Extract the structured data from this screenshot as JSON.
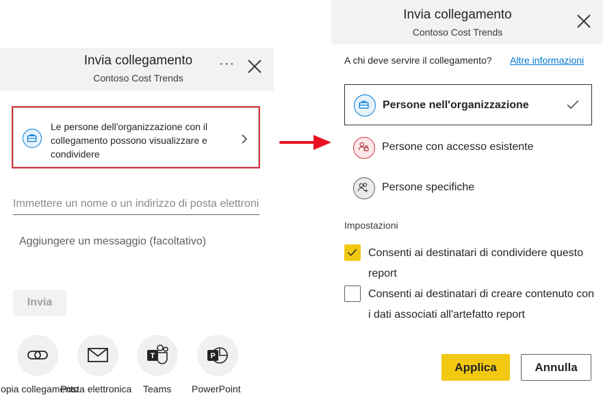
{
  "left_dialog": {
    "title": "Invia collegamento",
    "subtitle": "Contoso Cost Trends",
    "more_label": "···",
    "link_scope_text": "Le persone dell'organizzazione con il collegamento possono visualizzare e condividere",
    "recipient_placeholder": "Immettere un nome o un indirizzo di posta elettronica",
    "message_placeholder": "Aggiungere un messaggio (facoltativo)",
    "send_label": "Invia",
    "share_options": [
      {
        "label": "Copia collegamento",
        "icon": "link-icon"
      },
      {
        "label": "Posta elettronica",
        "icon": "mail-icon"
      },
      {
        "label": "Teams",
        "icon": "teams-icon"
      },
      {
        "label": "PowerPoint",
        "icon": "powerpoint-icon"
      }
    ]
  },
  "right_dialog": {
    "title": "Invia collegamento",
    "subtitle": "Contoso Cost Trends",
    "question": "A chi deve servire il collegamento?",
    "more_info": "Altre informazioni",
    "options": [
      {
        "label": "Persone nell'organizzazione",
        "selected": true,
        "icon": "briefcase-icon"
      },
      {
        "label": "Persone con accesso esistente",
        "selected": false,
        "icon": "people-lock-icon"
      },
      {
        "label": "Persone specifiche",
        "selected": false,
        "icon": "people-add-icon"
      }
    ],
    "settings_label": "Impostazioni",
    "settings": [
      {
        "label": "Consenti ai destinatari di condividere questo report",
        "checked": true
      },
      {
        "label": "Consenti ai destinatari di creare contenuto con i dati associati all'artefatto report",
        "checked": false
      }
    ],
    "apply_label": "Applica",
    "cancel_label": "Annulla"
  },
  "colors": {
    "accent_yellow": "#f2c811",
    "highlight_red": "#d13438",
    "link_blue": "#0078d4"
  }
}
